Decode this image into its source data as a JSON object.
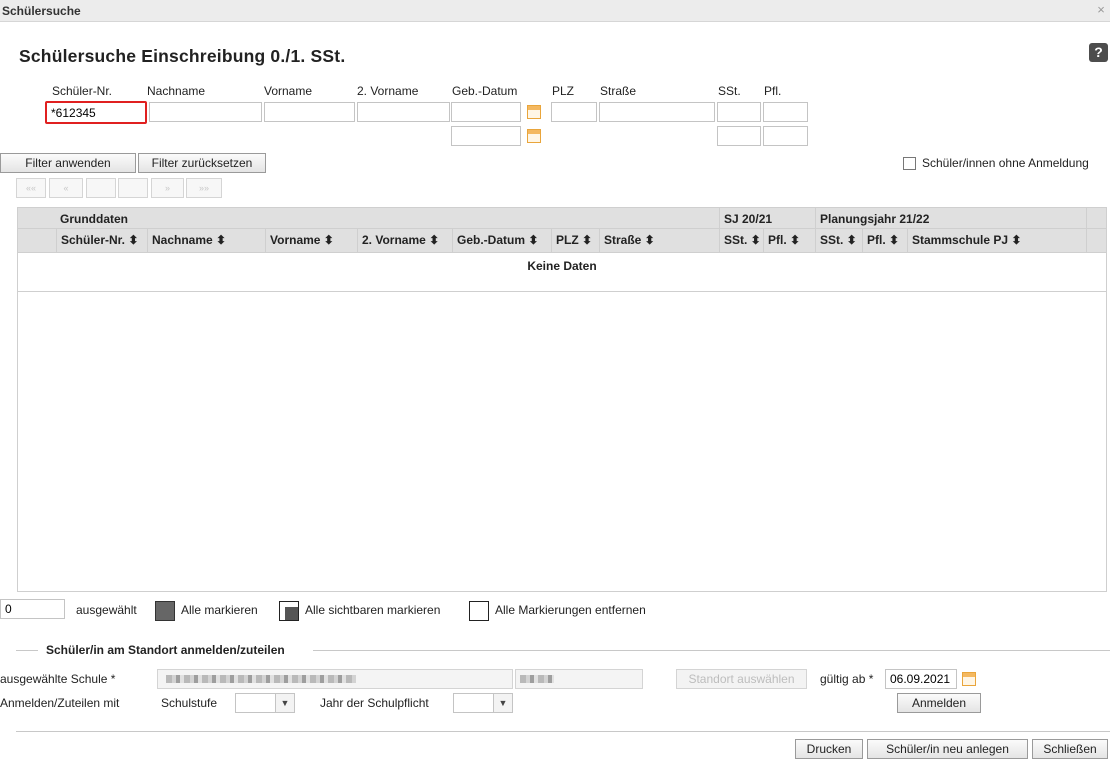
{
  "window": {
    "title": "Schülersuche",
    "close_symbol": "×"
  },
  "page": {
    "heading": "Schülersuche Einschreibung 0./1. SSt.",
    "help_symbol": "?"
  },
  "filters": {
    "labels": {
      "schueler_nr": "Schüler-Nr.",
      "nachname": "Nachname",
      "vorname": "Vorname",
      "zweiter_vorname": "2. Vorname",
      "geb_datum": "Geb.-Datum",
      "plz": "PLZ",
      "strasse": "Straße",
      "sst": "SSt.",
      "pfl": "Pfl."
    },
    "values": {
      "schueler_nr": "*612345"
    },
    "apply_label": "Filter anwenden",
    "reset_label": "Filter zurücksetzen",
    "ohne_anmeldung_label": "Schüler/innen ohne Anmeldung"
  },
  "pager": {
    "first": "««",
    "prev": "«",
    "next": "»",
    "last": "»»"
  },
  "grid": {
    "group_headers": {
      "grunddaten": "Grunddaten",
      "sj": "SJ 20/21",
      "planungsjahr": "Planungsjahr 21/22"
    },
    "columns": [
      "Schüler-Nr. ⬍",
      "Nachname ⬍",
      "Vorname ⬍",
      "2. Vorname ⬍",
      "Geb.-Datum ⬍",
      "PLZ ⬍",
      "Straße ⬍",
      "SSt. ⬍",
      "Pfl. ⬍",
      "SSt. ⬍",
      "Pfl. ⬍",
      "Stammschule PJ ⬍"
    ],
    "empty_text": "Keine Daten"
  },
  "selection": {
    "count": "0",
    "selected_label": "ausgewählt",
    "mark_all": "Alle markieren",
    "mark_visible": "Alle sichtbaren markieren",
    "clear_marks": "Alle Markierungen entfernen"
  },
  "assign": {
    "section_title": "Schüler/in am Standort anmelden/zuteilen",
    "school_label": "ausgewählte Schule *",
    "standort_button": "Standort auswählen",
    "gueltig_label": "gültig ab *",
    "gueltig_value": "06.09.2021",
    "mit_label": "Anmelden/Zuteilen mit",
    "schulstufe_label": "Schulstufe",
    "jahr_label": "Jahr der Schulpflicht",
    "anmelden_button": "Anmelden"
  },
  "footer": {
    "print": "Drucken",
    "new_student": "Schüler/in neu anlegen",
    "close": "Schließen"
  },
  "colors": {
    "highlight": "#e02020",
    "calendar": "#f4b860"
  }
}
